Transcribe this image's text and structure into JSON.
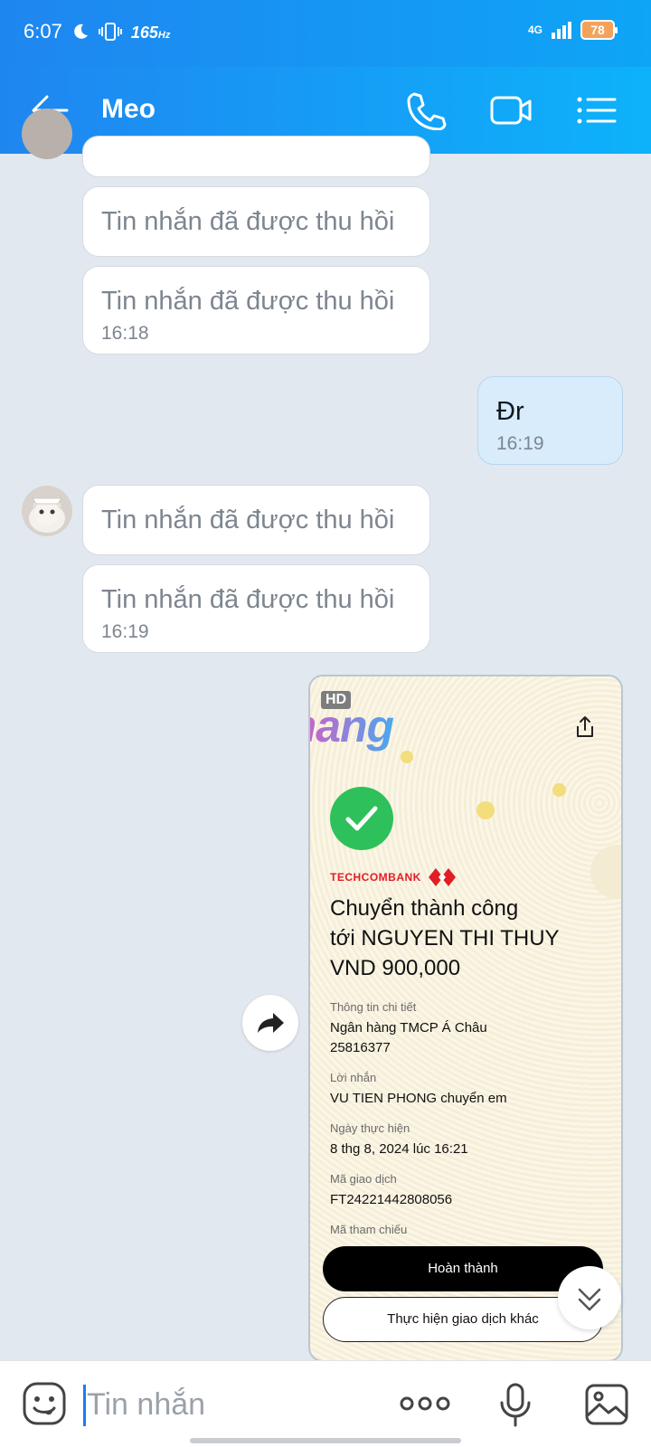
{
  "status_bar": {
    "time": "6:07",
    "refresh_rate": "165",
    "refresh_unit": "Hz",
    "network": "4G",
    "battery": "78"
  },
  "header": {
    "contact_name": "Meo"
  },
  "messages": [
    {
      "text": "Tin nhắn đã được thu hồi"
    },
    {
      "text": "Tin nhắn đã được thu hồi",
      "time": "16:18"
    },
    {
      "text": "Đr",
      "time": "16:19"
    },
    {
      "text": "Tin nhắn đã được thu hồi"
    },
    {
      "text": "Tin nhắn đã được thu hồi",
      "time": "16:19"
    }
  ],
  "receipt": {
    "hd_badge": "HD",
    "watermark": "Rphang",
    "bank_name": "TECHCOMBANK",
    "title_line1": "Chuyển thành công",
    "title_line2": "tới NGUYEN THI THUY",
    "title_line3": "VND 900,000",
    "detail_label": "Thông tin chi tiết",
    "detail_bank": "Ngân hàng TMCP Á Châu",
    "detail_account": "25816377",
    "message_label": "Lời nhắn",
    "message_value": "VU TIEN PHONG chuyển em",
    "date_label": "Ngày thực hiện",
    "date_value": "8 thg 8, 2024 lúc 16:21",
    "txn_label": "Mã giao dịch",
    "txn_value": "FT24221442808056",
    "ref_label": "Mã tham chiếu",
    "done_button": "Hoàn thành",
    "other_button": "Thực hiện giao dịch khác"
  },
  "input": {
    "placeholder": "Tin nhắn"
  },
  "colors": {
    "header": "#1f86f0",
    "accent": "#0db2fb",
    "own_bubble": "#d8ecfb",
    "success": "#2ec05a",
    "bank_red": "#e11d26"
  },
  "icons": [
    "back-arrow-icon",
    "phone-icon",
    "video-call-icon",
    "menu-list-icon",
    "forward-icon",
    "scroll-down-icon",
    "emoji-icon",
    "more-icon",
    "microphone-icon",
    "image-icon"
  ]
}
